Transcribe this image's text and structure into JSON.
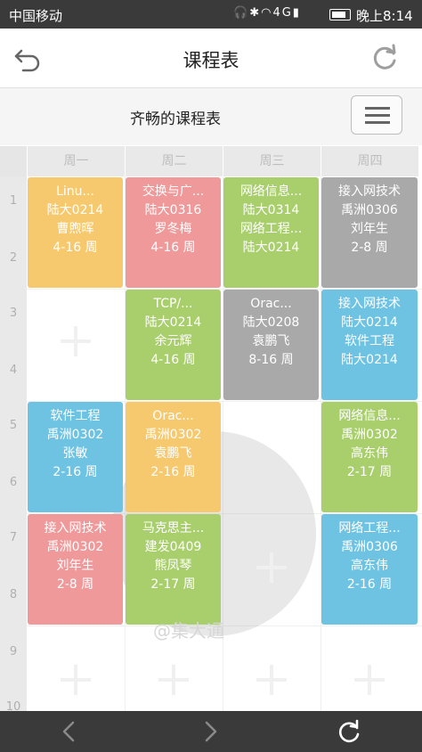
{
  "status_bar": {
    "carrier": "中国移动",
    "network": "4G",
    "time": "晚上8:14"
  },
  "header": {
    "title": "课程表",
    "back_icon": "back-arrow-icon",
    "refresh_icon": "refresh-icon"
  },
  "subheader": {
    "student_name": "齐畅的课程表",
    "menu_icon": "hamburger-menu-icon"
  },
  "days": [
    "周一",
    "周二",
    "周三",
    "周四"
  ],
  "periods": [
    "1",
    "2",
    "3",
    "4",
    "5",
    "6",
    "7",
    "8",
    "9",
    "10"
  ],
  "courses": [
    {
      "name": "Linu...",
      "room": "陆大0214",
      "teacher": "曹煦晖",
      "weeks": "4-16 周",
      "color": "#f7c96e"
    },
    {
      "name": "交换与广...",
      "room": "陆大0316",
      "teacher": "罗冬梅",
      "weeks": "4-16 周",
      "color": "#f0999a"
    },
    {
      "name": "网络信息...",
      "room": "陆大0314",
      "teacher": "网络工程...",
      "weeks": "陆大0214",
      "color": "#a9cf6d"
    },
    {
      "name": "接入网技术",
      "room": "禹洲0306",
      "teacher": "刘年生",
      "weeks": "2-8 周",
      "color": "#a9a9a9"
    },
    {
      "name": "TCP/...",
      "room": "陆大0214",
      "teacher": "余元辉",
      "weeks": "4-16 周",
      "color": "#a9cf6d"
    },
    {
      "name": "Orac...",
      "room": "陆大0208",
      "teacher": "袁鹏飞",
      "weeks": "8-16 周",
      "color": "#a9a9a9"
    },
    {
      "name": "接入网技术",
      "room": "陆大0214",
      "teacher": "软件工程",
      "weeks": "陆大0214",
      "color": "#6ec3e3"
    },
    {
      "name": "软件工程",
      "room": "禹洲0302",
      "teacher": "张敏",
      "weeks": "2-16 周",
      "color": "#6ec3e3"
    },
    {
      "name": "Orac...",
      "room": "禹洲0302",
      "teacher": "袁鹏飞",
      "weeks": "2-16 周",
      "color": "#f7c96e"
    },
    {
      "name": "网络信息...",
      "room": "禹洲0302",
      "teacher": "高东伟",
      "weeks": "2-17 周",
      "color": "#a9cf6d"
    },
    {
      "name": "接入网技术",
      "room": "禹洲0302",
      "teacher": "刘年生",
      "weeks": "2-8 周",
      "color": "#f0999a"
    },
    {
      "name": "马克思主...",
      "room": "建发0409",
      "teacher": "熊凤琴",
      "weeks": "2-17 周",
      "color": "#a9cf6d"
    },
    {
      "name": "网络工程...",
      "room": "禹洲0306",
      "teacher": "高东伟",
      "weeks": "2-16 周",
      "color": "#6ec3e3"
    }
  ],
  "watermark": "@集大通",
  "bottom_bar": {
    "back_icon": "chevron-left-icon",
    "forward_icon": "chevron-right-icon",
    "reload_icon": "refresh-icon"
  }
}
